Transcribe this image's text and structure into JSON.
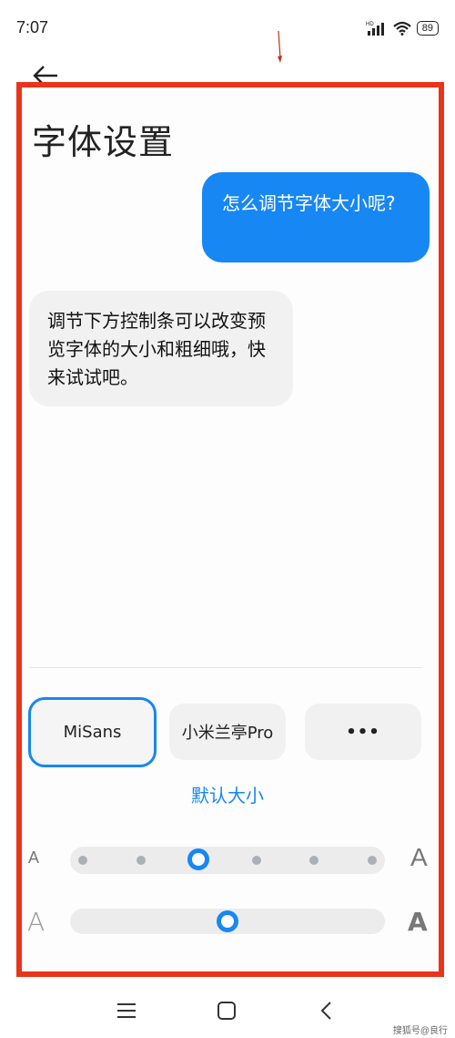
{
  "status_bar": {
    "time": "7:07",
    "network_label": "HD",
    "battery": "89"
  },
  "header": {
    "title": "字体设置"
  },
  "chat": {
    "user_message": "怎么调节字体大小呢?",
    "system_message": "调节下方控制条可以改变预览字体的大小和粗细哦，快来试试吧。"
  },
  "font_options": [
    {
      "label": "MiSans",
      "selected": true
    },
    {
      "label": "小米兰亭Pro",
      "selected": false
    },
    {
      "label": "•••",
      "selected": false
    }
  ],
  "default_size_label": "默认大小",
  "size_slider": {
    "min_label": "A",
    "max_label": "A",
    "steps": 6,
    "value_index": 2
  },
  "weight_slider": {
    "min_label": "A",
    "max_label": "A",
    "value_fraction": 0.5
  },
  "watermark": "搜狐号@良行",
  "colors": {
    "accent": "#1787f4",
    "annotation_frame": "#e8341a",
    "system_bubble": "#f1f1f1"
  }
}
